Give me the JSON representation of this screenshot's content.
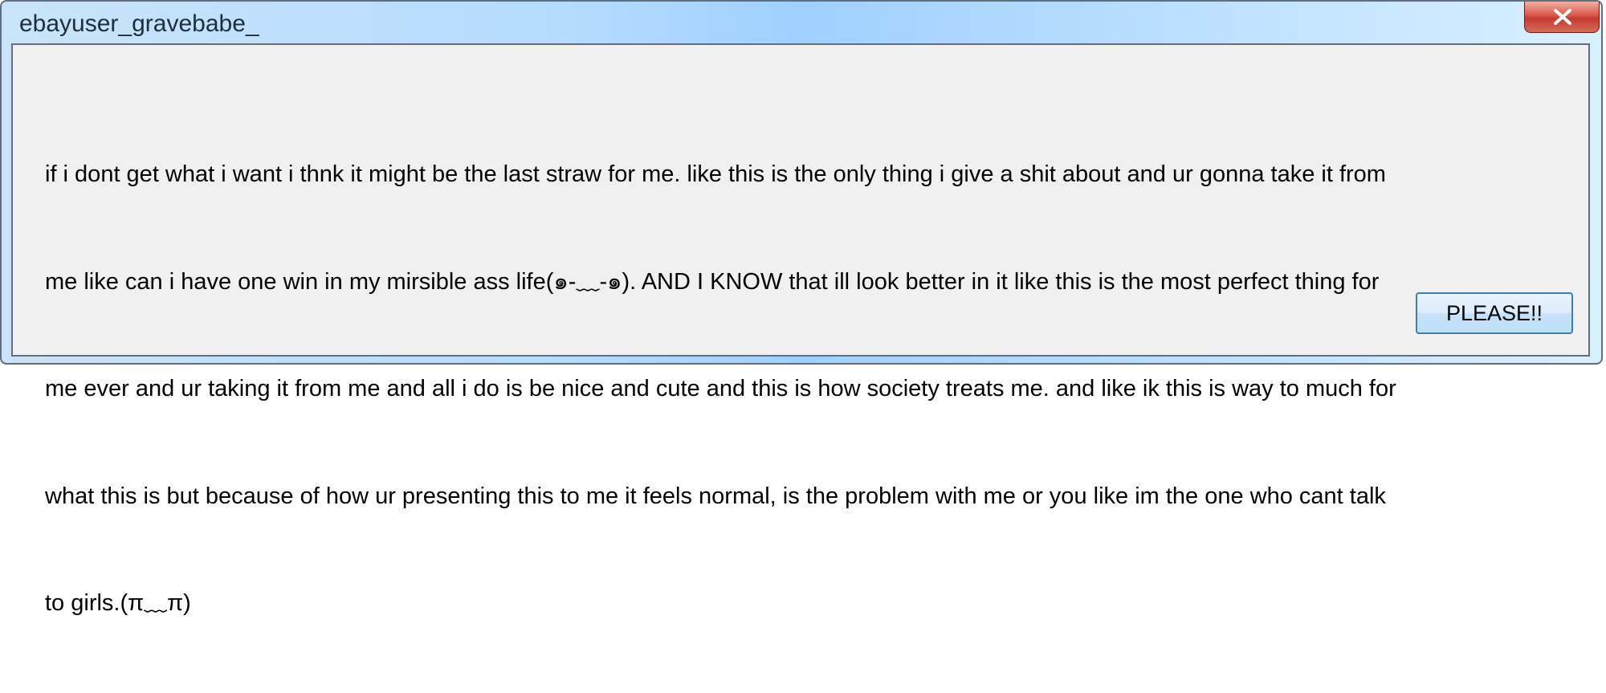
{
  "window": {
    "title": "ebayuser_gravebabe_",
    "close_icon": "close-x-icon"
  },
  "dialog": {
    "message_lines": [
      "if i dont get what i want i thnk it might be the last straw for me. like this is the only thing i give a shit about and ur gonna take it from",
      "me like can i have one win in my mirsible ass life(๑-﹏-๑). AND I KNOW that ill look better in it like this is the most perfect thing for",
      "me ever and ur taking it from me and all i do is be nice and cute and this is how society treats me. and like ik this is way to much for",
      "what this is but because of how ur presenting this to me it feels normal, is the problem with me or you like im the one who cant talk",
      "to girls.(π﹏π)"
    ],
    "button_label": "PLEASE!!"
  },
  "colors": {
    "titlebar_gradient_center": "#9fd0ff",
    "content_background": "#f0f0f0",
    "close_button": "#c43a2e",
    "button_border": "#3c7fb1"
  }
}
